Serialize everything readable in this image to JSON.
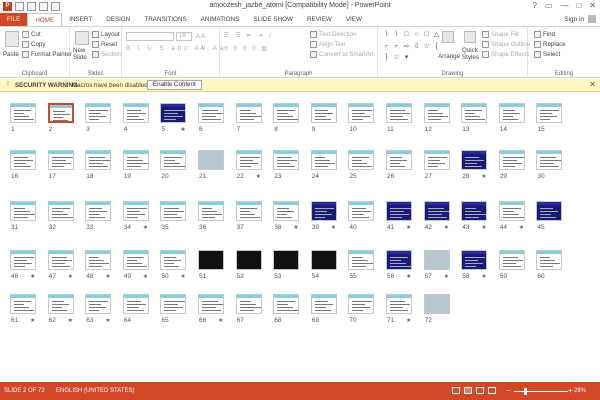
{
  "window": {
    "title": "amoozesh_jazbe_atomi [Compatibility Mode] - PowerPoint",
    "controls": {
      "help": "?",
      "restore": "▭",
      "minimize": "—",
      "maximize": "□",
      "close": "✕"
    }
  },
  "tabs": [
    "FILE",
    "HOME",
    "INSERT",
    "DESIGN",
    "TRANSITIONS",
    "ANIMATIONS",
    "SLIDE SHOW",
    "REVIEW",
    "VIEW"
  ],
  "active_tab": "HOME",
  "account": {
    "signin": "Sign in"
  },
  "ribbon": {
    "clipboard": {
      "paste": "Paste",
      "cut": "Cut",
      "copy": "Copy",
      "format_painter": "Format Painter",
      "label": "Clipboard"
    },
    "slides": {
      "new_slide": "New Slide",
      "layout": "Layout",
      "reset": "Reset",
      "section": "Section",
      "label": "Slides"
    },
    "font": {
      "size": "18",
      "label": "Font"
    },
    "paragraph": {
      "text_direction": "Text Direction",
      "align_text": "Align Text",
      "convert": "Convert to SmartArt",
      "label": "Paragraph"
    },
    "drawing": {
      "arrange": "Arrange",
      "quick_styles": "Quick Styles",
      "shape_fill": "Shape Fill",
      "shape_outline": "Shape Outline",
      "shape_effects": "Shape Effects",
      "label": "Drawing"
    },
    "editing": {
      "find": "Find",
      "replace": "Replace",
      "select": "Select",
      "label": "Editing"
    }
  },
  "security": {
    "title": "SECURITY WARNING",
    "message": "Macros have been disabled.",
    "button": "Enable Content"
  },
  "slides": {
    "selected": 2,
    "rows": [
      [
        1,
        2,
        3,
        4,
        5,
        6,
        7,
        8,
        9,
        10,
        11,
        12,
        13,
        14,
        15
      ],
      [
        16,
        17,
        18,
        19,
        20,
        21,
        22,
        23,
        24,
        25,
        26,
        27,
        28,
        29,
        30
      ],
      [
        31,
        32,
        33,
        34,
        35,
        36,
        37,
        38,
        39,
        40,
        41,
        42,
        43,
        44,
        45
      ],
      [
        46,
        47,
        48,
        49,
        50,
        51,
        52,
        53,
        54,
        55,
        56,
        57,
        58,
        59,
        60
      ],
      [
        61,
        62,
        63,
        64,
        65,
        66,
        67,
        68,
        69,
        70,
        71,
        72
      ]
    ],
    "starred": [
      5,
      22,
      28,
      34,
      38,
      39,
      41,
      42,
      43,
      44,
      46,
      47,
      48,
      49,
      50,
      56,
      57,
      58,
      61,
      62,
      63,
      66,
      71
    ],
    "dark": [
      5,
      28,
      39,
      41,
      42,
      43,
      45,
      56,
      58
    ],
    "black": [
      51,
      52,
      53,
      54
    ],
    "photo": [
      21,
      57,
      72
    ],
    "numbers": [
      "1",
      "2",
      "3",
      "4",
      "5",
      "6",
      "7",
      "8",
      "9",
      "10",
      "11",
      "12",
      "13",
      "14",
      "15",
      "16",
      "17",
      "18",
      "19",
      "20",
      "21",
      "22",
      "23",
      "24",
      "25",
      "26",
      "27",
      "28",
      "29",
      "30",
      "31",
      "32",
      "33",
      "34",
      "35",
      "36",
      "37",
      "38",
      "39",
      "40",
      "41",
      "42",
      "43",
      "44",
      "45",
      "46",
      "47",
      "48",
      "49",
      "50",
      "51",
      "52",
      "53",
      "54",
      "55",
      "56",
      "57",
      "58",
      "59",
      "60",
      "61",
      "62",
      "63",
      "64",
      "65",
      "66",
      "67",
      "68",
      "69",
      "70",
      "71",
      "72"
    ]
  },
  "status": {
    "slide_info": "SLIDE 2 OF 72",
    "language": "ENGLISH (UNITED STATES)",
    "zoom": "28%",
    "zoom_minus": "−",
    "zoom_plus": "+"
  }
}
